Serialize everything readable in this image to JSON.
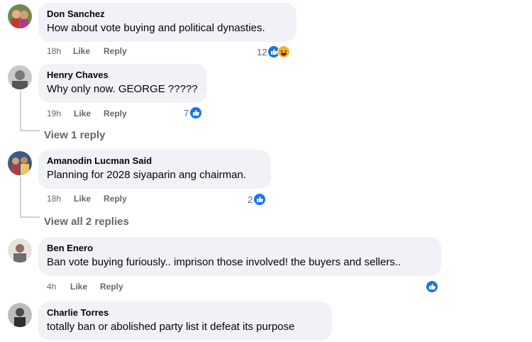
{
  "comments": [
    {
      "author": "Don Sanchez",
      "text": "How about vote buying and political dynasties.",
      "time": "18h",
      "like": "Like",
      "reply": "Reply",
      "reactions": "12"
    },
    {
      "author": "Henry Chaves",
      "text": "Why only now. GEORGE ?????",
      "time": "19h",
      "like": "Like",
      "reply": "Reply",
      "reactions": "7",
      "view_replies": "View 1 reply"
    },
    {
      "author": "Amanodin Lucman Said",
      "text": "Planning for 2028 siyaparin ang chairman.",
      "time": "18h",
      "like": "Like",
      "reply": "Reply",
      "reactions": "2",
      "view_replies": "View all 2 replies"
    },
    {
      "author": "Ben Enero",
      "text": "Ban vote buying furiously.. imprison those involved! the buyers and sellers..",
      "time": "4h",
      "like": "Like",
      "reply": "Reply"
    },
    {
      "author": "Charlie Torres",
      "text": "totally ban or abolished party list it defeat its purpose"
    }
  ],
  "icons": {
    "like": "thumbs-up-icon",
    "haha": "laughing-face-icon"
  },
  "colors": {
    "bubble": "#f0f2f5",
    "like_blue": "#1b74e4",
    "meta_gray": "#65676b"
  }
}
